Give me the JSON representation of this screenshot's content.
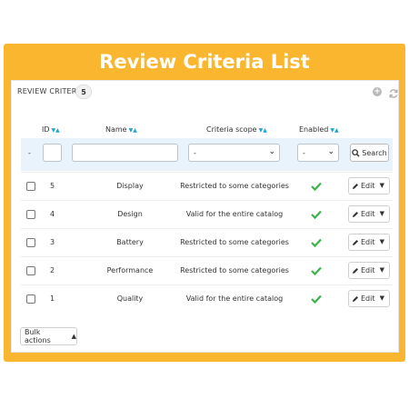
{
  "banner": {
    "title": "Review Criteria List"
  },
  "panel": {
    "title": "REVIEW CRITERIA",
    "count": "5"
  },
  "columns": {
    "id": "ID",
    "name": "Name",
    "scope": "Criteria scope",
    "enabled": "Enabled"
  },
  "filters": {
    "dash": "-",
    "scope_value": "-",
    "enabled_value": "-",
    "search_label": "Search"
  },
  "rows": [
    {
      "id": "5",
      "name": "Display",
      "scope": "Restricted to some categories",
      "edit": "Edit"
    },
    {
      "id": "4",
      "name": "Design",
      "scope": "Valid for the entire catalog",
      "edit": "Edit"
    },
    {
      "id": "3",
      "name": "Battery",
      "scope": "Restricted to some categories",
      "edit": "Edit"
    },
    {
      "id": "2",
      "name": "Performance",
      "scope": "Restricted to some categories",
      "edit": "Edit"
    },
    {
      "id": "1",
      "name": "Quality",
      "scope": "Valid for the entire catalog",
      "edit": "Edit"
    }
  ],
  "bulk_actions": "Bulk actions",
  "colors": {
    "frame": "#fbb62f",
    "accent": "#1ea3d6",
    "check": "#3bb24a",
    "filter_bg": "#e9f3fb"
  },
  "icons": {
    "add": "plus-circle-icon",
    "refresh": "refresh-icon",
    "search": "search-icon",
    "edit": "pencil-icon",
    "check": "check-icon"
  }
}
